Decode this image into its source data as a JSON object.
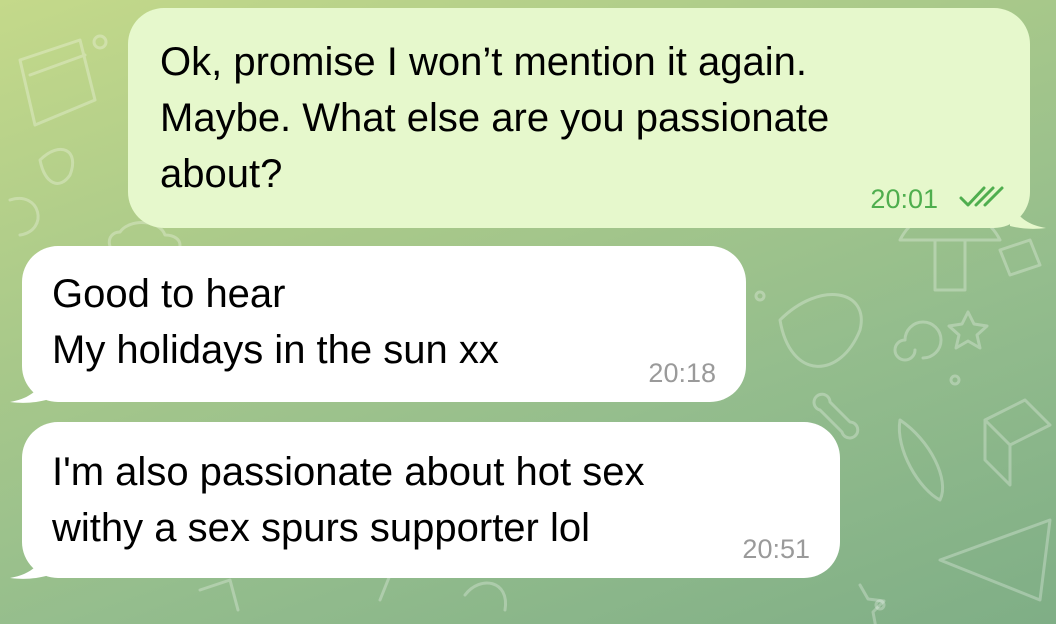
{
  "chat": {
    "messages": [
      {
        "direction": "outgoing",
        "lines": [
          "Ok, promise I won’t mention it again.",
          "Maybe. What else are you passionate",
          "about?"
        ],
        "time": "20:01",
        "status": "read-double-check-icon"
      },
      {
        "direction": "incoming",
        "lines": [
          "Good to hear",
          "My holidays in the sun xx"
        ],
        "time": "20:18"
      },
      {
        "direction": "incoming",
        "lines": [
          "I'm also passionate about hot sex",
          "withy a sex spurs supporter lol"
        ],
        "time": "20:51"
      }
    ]
  },
  "colors": {
    "outgoing_bubble": "#e6f8cc",
    "incoming_bubble": "#ffffff",
    "outgoing_time": "#4fae4e",
    "incoming_time": "#9a9a9a"
  }
}
